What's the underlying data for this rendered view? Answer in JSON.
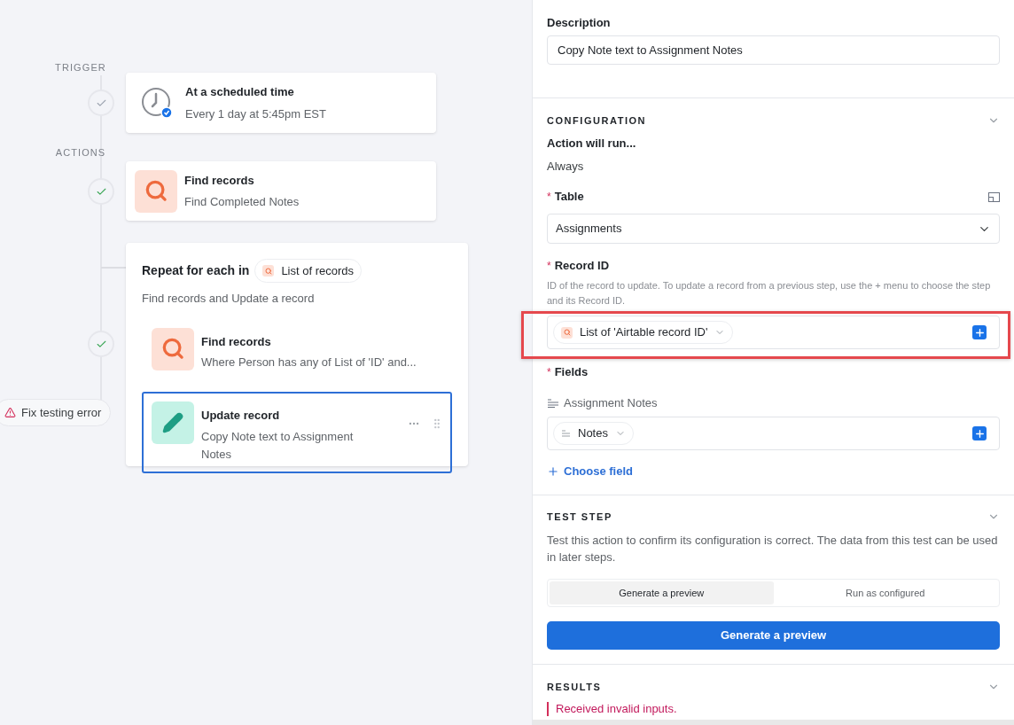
{
  "canvas": {
    "trigger": {
      "heading": "TRIGGER",
      "passed": false,
      "title": "At a scheduled time",
      "subtitle": "Every 1 day at 5:45pm EST"
    },
    "actions": {
      "heading": "ACTIONS",
      "steps": [
        {
          "kind": "find",
          "passed": true,
          "title": "Find records",
          "subtitle": "Find Completed Notes"
        },
        {
          "kind": "repeat",
          "passed": true,
          "title": "Repeat for each in",
          "source": "List of records",
          "subtitle": "Find records and Update a record",
          "children": [
            {
              "kind": "find",
              "title": "Find records",
              "subtitle": "Where Person has any of List of 'ID' and...",
              "selected": false
            },
            {
              "kind": "update",
              "title": "Update record",
              "subtitle": "Copy Note text to Assignment Notes",
              "selected": true
            }
          ]
        }
      ]
    },
    "error_badge": "Fix testing error"
  },
  "panel": {
    "description": {
      "label": "Description",
      "value": "Copy Note text to Assignment Notes"
    },
    "configuration": {
      "heading": "CONFIGURATION",
      "expanded": true,
      "run_label": "Action will run...",
      "run_value": "Always",
      "table": {
        "label": "Table",
        "required_mark": "*",
        "value": "Assignments"
      },
      "record_id": {
        "label": "Record ID",
        "required_mark": "*",
        "help": "ID of the record to update. To update a record from a previous step, use the + menu to choose the step and its Record ID.",
        "token": "List of 'Airtable record ID'",
        "highlighted": true
      },
      "fields": {
        "label": "Fields",
        "required_mark": "*",
        "items": [
          {
            "name": "Assignment Notes",
            "token": "Notes"
          }
        ],
        "add_label": "Choose field"
      }
    },
    "test_step": {
      "heading": "TEST STEP",
      "expanded": true,
      "text": "Test this action to confirm its configuration is correct. The data from this test can be used in later steps.",
      "modes": [
        {
          "label": "Generate a preview",
          "selected": true
        },
        {
          "label": "Run as configured",
          "selected": false
        }
      ],
      "button": "Generate a preview"
    },
    "results": {
      "heading": "RESULTS",
      "expanded": true,
      "error": "Received invalid inputs."
    }
  }
}
